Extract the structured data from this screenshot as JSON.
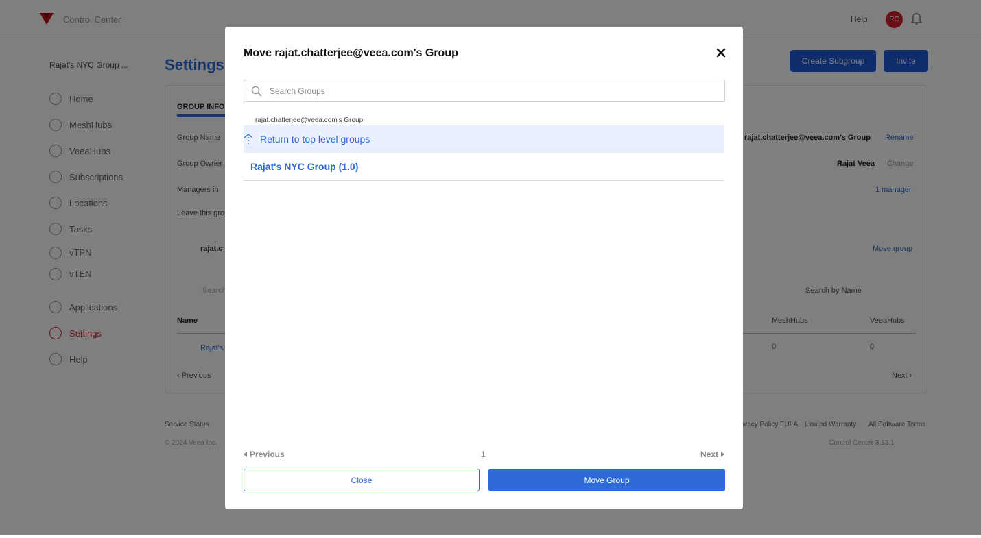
{
  "app": {
    "title": "Control Center",
    "help_label": "Help",
    "avatar_initials": "RC",
    "group_selector": "Rajat's NYC Group ...",
    "page_title": "Settings",
    "create_subgroup_label": "Create Subgroup",
    "invite_label": "Invite",
    "sidebar": [
      {
        "label": "Home"
      },
      {
        "label": "MeshHubs"
      },
      {
        "label": "VeeaHubs"
      },
      {
        "label": "Subscriptions"
      },
      {
        "label": "Locations"
      },
      {
        "label": "Tasks"
      },
      {
        "label": "vTPN"
      },
      {
        "label": "vTEN"
      },
      {
        "label": "Applications"
      },
      {
        "label": "Settings"
      },
      {
        "label": "Help"
      }
    ],
    "card": {
      "tab_label": "GROUP INFO",
      "rows": [
        {
          "label": "Group Name",
          "value": "rajat.chatterjee@veea.com's Group",
          "action": "Rename"
        },
        {
          "label": "Group Owner",
          "value": "Rajat Veea",
          "action": "Change"
        },
        {
          "label": "Managers in",
          "value": "",
          "action": "1 manager"
        }
      ],
      "leave_text": "Leave this group",
      "subgroup_name": "rajat.c",
      "move_group_link": "Move group",
      "search_placeholder": "Search",
      "search_by": "Search by Name",
      "table_headers": [
        "Name",
        "MeshHubs",
        "VeeaHubs"
      ],
      "table_row": {
        "name": "Rajat's",
        "meshhubs": "0",
        "veeahubs": "0"
      },
      "pager_prev": "‹ Previous",
      "pager_next": "Next ›"
    },
    "footer": {
      "links_left": "Service Status",
      "links_right": [
        "Privacy Policy",
        "EULA",
        "Limited Warranty",
        "All Software Terms"
      ],
      "copyright": "© 2024 Veea Inc.",
      "version": "Control Center 3.13.1"
    }
  },
  "modal": {
    "title": "Move rajat.chatterjee@veea.com's Group",
    "search_placeholder": "Search Groups",
    "current_group": "rajat.chatterjee@veea.com's Group",
    "return_label": "Return to top level groups",
    "groups": [
      {
        "label": "Rajat's NYC Group (1.0)"
      }
    ],
    "pager": {
      "previous": "Previous",
      "page": "1",
      "next": "Next"
    },
    "close_label": "Close",
    "move_label": "Move Group"
  },
  "colors": {
    "accent": "#2f6bd8",
    "brand_red": "#d61f2c",
    "selected_row_bg": "#e9f0fd",
    "overlay": "rgba(0,0,0,0.5)"
  }
}
